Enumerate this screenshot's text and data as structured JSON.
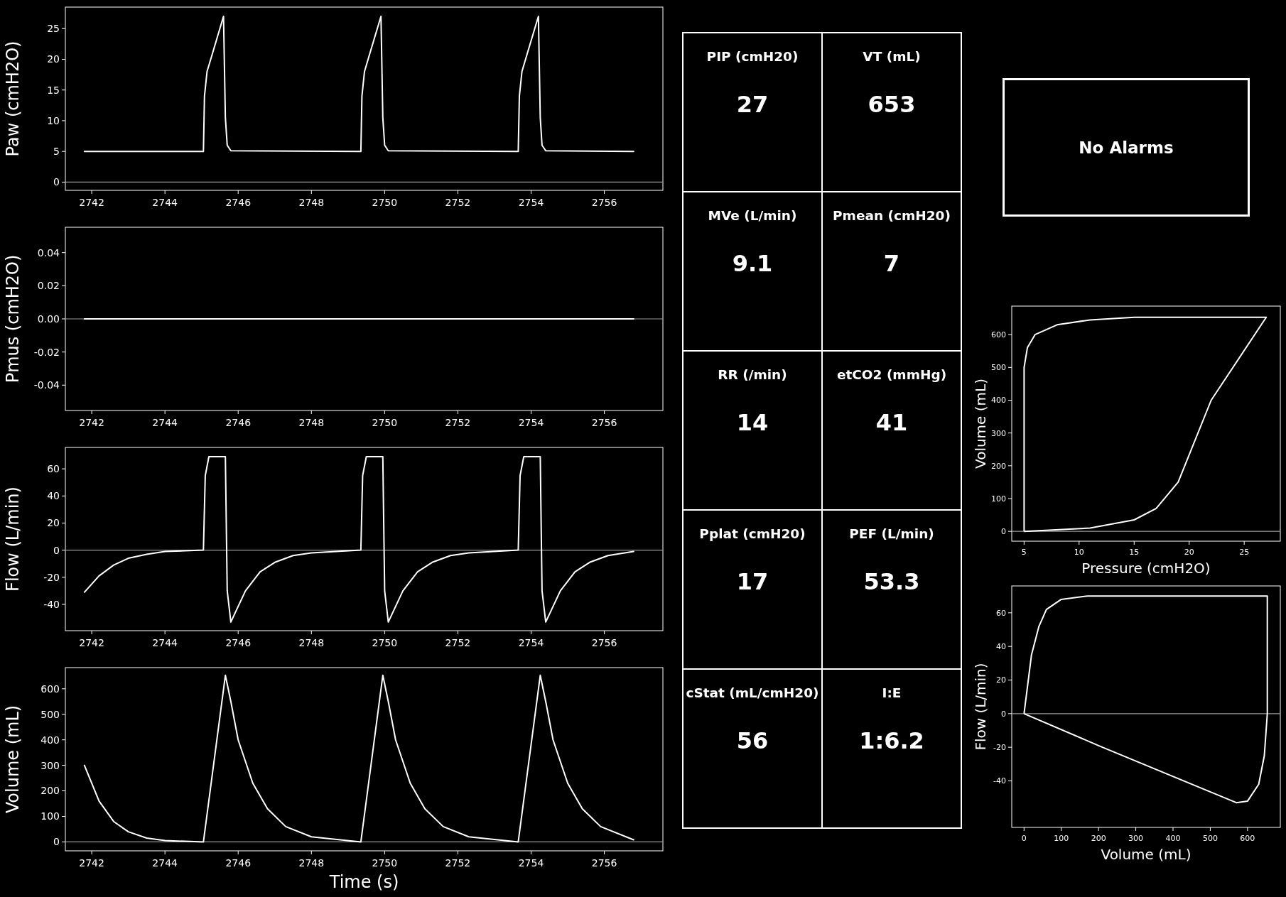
{
  "waveforms": [
    {
      "chart_data": {
        "type": "line",
        "ylabel": "Paw (cmH2O)",
        "xlim": [
          2741.28,
          2757.6
        ],
        "ylim": [
          -1.34,
          28.5
        ],
        "xticks": [
          2742,
          2744,
          2746,
          2748,
          2750,
          2752,
          2754,
          2756
        ],
        "yticks": [
          0,
          5,
          10,
          15,
          20,
          25
        ],
        "x": [
          2741.8,
          2745.05,
          2745.08,
          2745.15,
          2745.3,
          2745.6,
          2745.65,
          2745.7,
          2745.8,
          2749.35,
          2749.38,
          2749.45,
          2749.6,
          2749.9,
          2749.95,
          2750.0,
          2750.1,
          2753.65,
          2753.68,
          2753.75,
          2753.9,
          2754.2,
          2754.25,
          2754.3,
          2754.4,
          2756.8
        ],
        "series": [
          {
            "color": "#ffffff",
            "values": [
              5,
              5,
              14,
              18,
              21,
              27,
              10.5,
              6,
              5.1,
              5,
              14,
              18,
              21,
              27,
              10.5,
              6,
              5.1,
              5,
              14,
              18,
              21,
              27,
              10.5,
              6,
              5.1,
              5
            ]
          }
        ]
      }
    },
    {
      "chart_data": {
        "type": "line",
        "ylabel": "Pmus (cmH2O)",
        "xlim": [
          2741.28,
          2757.6
        ],
        "ylim": [
          -0.0553,
          0.0553
        ],
        "xticks": [
          2742,
          2744,
          2746,
          2748,
          2750,
          2752,
          2754,
          2756
        ],
        "yticks": [
          {
            "value": -0.04,
            "label": "-0.04"
          },
          {
            "value": -0.02,
            "label": "-0.02"
          },
          {
            "value": 0,
            "label": "0.00"
          },
          {
            "value": 0.02,
            "label": "0.02"
          },
          {
            "value": 0.04,
            "label": "0.04"
          }
        ],
        "x": [
          2741.8,
          2756.8
        ],
        "series": [
          {
            "color": "#ffffff",
            "values": [
              0,
              0
            ]
          }
        ]
      }
    },
    {
      "chart_data": {
        "type": "line",
        "ylabel": "Flow (L/min)",
        "xlim": [
          2741.28,
          2757.6
        ],
        "ylim": [
          -59.4,
          75.8
        ],
        "xticks": [
          2742,
          2744,
          2746,
          2748,
          2750,
          2752,
          2754,
          2756
        ],
        "yticks": [
          -40,
          -20,
          0,
          20,
          40,
          60
        ],
        "x": [
          2741.8,
          2742.2,
          2742.6,
          2743,
          2743.5,
          2744,
          2745.05,
          2745.1,
          2745.2,
          2745.65,
          2745.7,
          2745.8,
          2746.2,
          2746.6,
          2747,
          2747.5,
          2748,
          2749.35,
          2749.4,
          2749.5,
          2749.95,
          2750.0,
          2750.1,
          2750.5,
          2750.9,
          2751.3,
          2751.8,
          2752.3,
          2753.65,
          2753.7,
          2753.8,
          2754.25,
          2754.3,
          2754.4,
          2754.8,
          2755.2,
          2755.6,
          2756.1,
          2756.8
        ],
        "series": [
          {
            "color": "#ffffff",
            "values": [
              -31,
              -19,
              -11,
              -6,
              -3,
              -1,
              0,
              55,
              69,
              69,
              -30,
              -53,
              -30,
              -16,
              -9,
              -4,
              -2,
              0,
              55,
              69,
              69,
              -30,
              -53,
              -30,
              -16,
              -9,
              -4,
              -2,
              0,
              55,
              69,
              69,
              -30,
              -53,
              -30,
              -16,
              -9,
              -4,
              -1
            ]
          }
        ]
      }
    },
    {
      "chart_data": {
        "type": "line",
        "xlabel": "Time (s)",
        "ylabel": "Volume (mL)",
        "xlim": [
          2741.28,
          2757.6
        ],
        "ylim": [
          -35,
          683
        ],
        "xticks": [
          2742,
          2744,
          2746,
          2748,
          2750,
          2752,
          2754,
          2756
        ],
        "yticks": [
          0,
          100,
          200,
          300,
          400,
          500,
          600
        ],
        "x": [
          2741.8,
          2742.2,
          2742.6,
          2743,
          2743.5,
          2744,
          2745.05,
          2745.65,
          2745.8,
          2746,
          2746.4,
          2746.8,
          2747.3,
          2748,
          2749.35,
          2749.95,
          2750.1,
          2750.3,
          2750.7,
          2751.1,
          2751.6,
          2752.3,
          2753.65,
          2754.25,
          2754.4,
          2754.6,
          2755,
          2755.4,
          2755.9,
          2756.8
        ],
        "series": [
          {
            "color": "#ffffff",
            "values": [
              300,
              160,
              80,
              40,
              15,
              5,
              0,
              653,
              550,
              400,
              230,
              130,
              60,
              20,
              0,
              653,
              550,
              400,
              230,
              130,
              60,
              20,
              0,
              653,
              550,
              400,
              230,
              130,
              60,
              8
            ]
          }
        ]
      }
    }
  ],
  "metrics": [
    {
      "label": "PIP (cmH20)",
      "value": "27"
    },
    {
      "label": "VT (mL)",
      "value": "653"
    },
    {
      "label": "MVe (L/min)",
      "value": "9.1"
    },
    {
      "label": "Pmean (cmH20)",
      "value": "7"
    },
    {
      "label": "RR (/min)",
      "value": "14"
    },
    {
      "label": "etCO2 (mmHg)",
      "value": "41"
    },
    {
      "label": "Pplat (cmH20)",
      "value": "17"
    },
    {
      "label": "PEF (L/min)",
      "value": "53.3"
    },
    {
      "label": "cStat (mL/cmH20)",
      "value": "56"
    },
    {
      "label": "I:E",
      "value": "1:6.2"
    }
  ],
  "alarm": {
    "text": "No Alarms"
  },
  "loops": [
    {
      "chart_data": {
        "type": "line",
        "xlabel": "Pressure (cmH2O)",
        "ylabel": "Volume (mL)",
        "xlim": [
          3.88,
          28.28
        ],
        "ylim": [
          -30,
          687
        ],
        "xticks": [
          5,
          10,
          15,
          20,
          25
        ],
        "yticks": [
          0,
          100,
          200,
          300,
          400,
          500,
          600
        ]
      }
    },
    {
      "chart_data": {
        "type": "line",
        "xlabel": "Volume (mL)",
        "ylabel": "Flow (L/min)",
        "xlim": [
          -33,
          688
        ],
        "ylim": [
          -67.7,
          76
        ],
        "xticks": [
          0,
          100,
          200,
          300,
          400,
          500,
          600
        ],
        "yticks": [
          -40,
          -20,
          0,
          20,
          40,
          60
        ]
      }
    }
  ]
}
